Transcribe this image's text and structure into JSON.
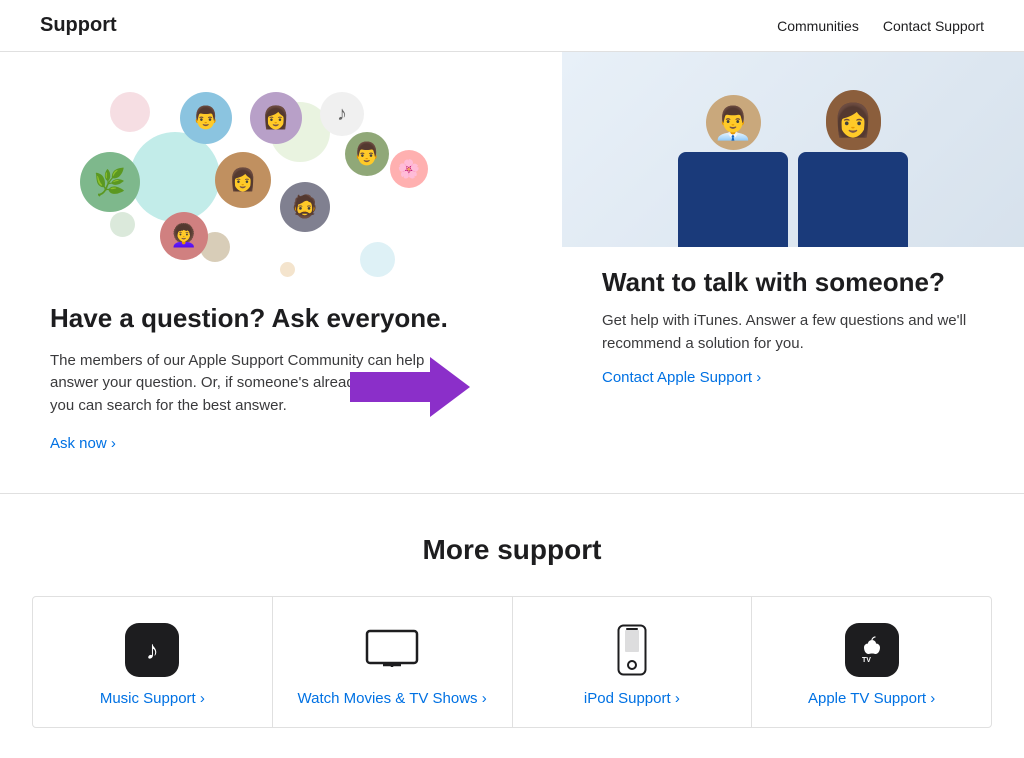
{
  "header": {
    "logo": "Support",
    "nav": [
      {
        "label": "Communities",
        "id": "communities"
      },
      {
        "label": "Contact Support",
        "id": "contact-support"
      }
    ]
  },
  "left_panel": {
    "heading": "Have a question? Ask everyone.",
    "body": "The members of our Apple Support Community can help answer your question. Or, if someone's already asked, you can search for the best answer.",
    "cta_label": "Ask now ›"
  },
  "right_panel": {
    "heading": "Want to talk with someone?",
    "body": "Get help with iTunes. Answer a few questions and we'll recommend a solution for you.",
    "cta_label": "Contact Apple Support ›"
  },
  "more_support": {
    "heading": "More support",
    "items": [
      {
        "id": "music",
        "icon_type": "rounded",
        "icon_symbol": "♪",
        "label": "Music Support ›"
      },
      {
        "id": "watch-movies",
        "icon_type": "outline-tv",
        "label": "Watch Movies & TV Shows ›"
      },
      {
        "id": "ipod",
        "icon_type": "outline-phone",
        "label": "iPod Support ›"
      },
      {
        "id": "apple-tv",
        "icon_type": "tv-rounded",
        "label": "Apple TV Support ›"
      }
    ]
  }
}
